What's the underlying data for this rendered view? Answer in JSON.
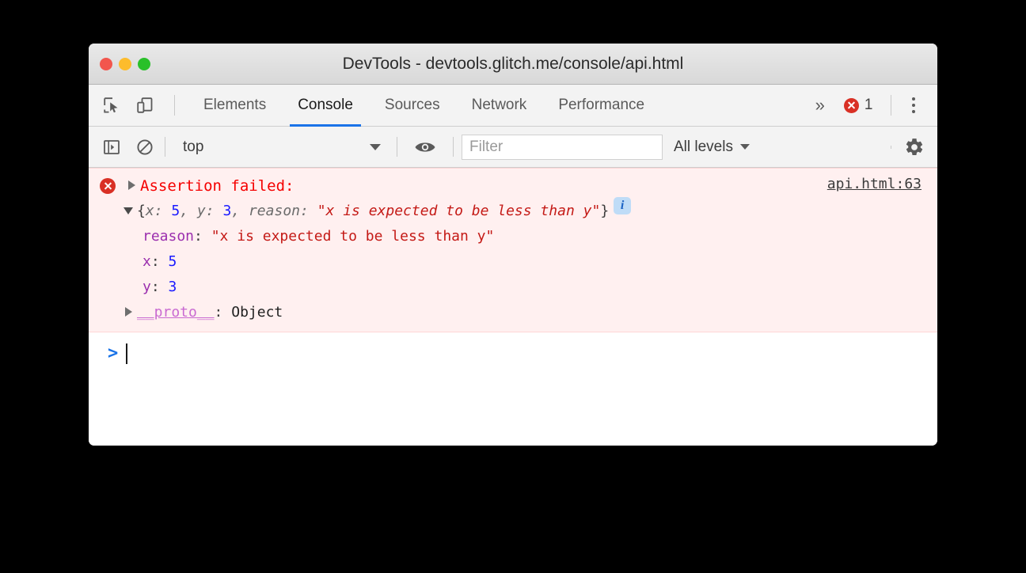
{
  "window": {
    "title": "DevTools - devtools.glitch.me/console/api.html",
    "traffic_lights": [
      "close-red",
      "minimize-yellow",
      "maximize-green"
    ],
    "colors": {
      "red": "#f2564d",
      "yellow": "#fdbc2c",
      "green": "#2ac02a",
      "accent_blue": "#1a73e8",
      "error_red": "#d93025",
      "error_bg": "#fff0f0",
      "error_border": "#ffd6d6"
    }
  },
  "tabstrip": {
    "inspect_icon": "inspect-element-icon",
    "device_icon": "device-toolbar-icon",
    "tabs": [
      {
        "label": "Elements",
        "active": false
      },
      {
        "label": "Console",
        "active": true
      },
      {
        "label": "Sources",
        "active": false
      },
      {
        "label": "Network",
        "active": false
      },
      {
        "label": "Performance",
        "active": false
      }
    ],
    "more_tabs": "»",
    "error_count": "1",
    "error_icon": "error-circle-icon",
    "menu_icon": "kebab-menu-icon"
  },
  "console_toolbar": {
    "sidebar_toggle_icon": "console-sidebar-toggle-icon",
    "clear_icon": "clear-console-icon",
    "context": "top",
    "context_caret": "chevron-down-icon",
    "eye_icon": "live-expression-eye-icon",
    "filter_placeholder": "Filter",
    "filter_value": "",
    "levels": "All levels",
    "levels_caret": "chevron-down-icon",
    "settings_icon": "settings-gear-icon"
  },
  "console": {
    "message": {
      "severity": "error",
      "header_text": "Assertion failed:",
      "source_link": "api.html:63",
      "preview": {
        "open_brace": "{",
        "k_x": "x",
        "colon": ": ",
        "v_x": "5",
        "sep1": ", ",
        "k_y": "y",
        "v_y": "3",
        "sep2": ", ",
        "k_reason": "reason",
        "v_reason": "\"x is expected to be less than y\"",
        "close_brace": "}",
        "info_badge": "i"
      },
      "properties": [
        {
          "key": "reason",
          "colon": ": ",
          "value": "\"x is expected to be less than y\"",
          "kind": "string"
        },
        {
          "key": "x",
          "colon": ": ",
          "value": "5",
          "kind": "number"
        },
        {
          "key": "y",
          "colon": ": ",
          "value": "3",
          "kind": "number"
        },
        {
          "key": "__proto__",
          "colon": ": ",
          "value": "Object",
          "kind": "object"
        }
      ]
    },
    "prompt": {
      "arrow": ">",
      "value": ""
    }
  }
}
